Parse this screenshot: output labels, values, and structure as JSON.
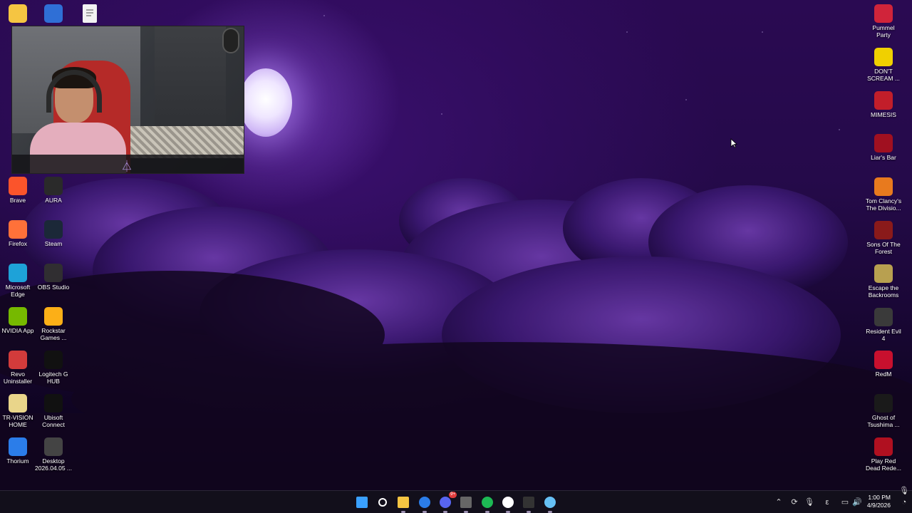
{
  "desktop": {
    "left_column_1": [
      {
        "label": "",
        "icon": "folder-icon",
        "color": "#f5c542"
      },
      {
        "label": "Brave",
        "icon": "brave-icon",
        "color": "#fb542b"
      },
      {
        "label": "Firefox",
        "icon": "firefox-icon",
        "color": "#ff7139"
      },
      {
        "label": "Microsoft Edge",
        "icon": "edge-icon",
        "color": "#1ea2d8"
      },
      {
        "label": "NVIDIA App",
        "icon": "nvidia-icon",
        "color": "#76b900"
      },
      {
        "label": "Revo Uninstaller",
        "icon": "revo-icon",
        "color": "#d23b3b"
      },
      {
        "label": "TR-VISION HOME",
        "icon": "trvision-icon",
        "color": "#e9d58a"
      },
      {
        "label": "Thorium",
        "icon": "thorium-icon",
        "color": "#2b7de9"
      }
    ],
    "left_column_2": [
      {
        "label": "",
        "icon": "settings-app-icon",
        "color": "#2f6fd6"
      },
      {
        "label": "AURA",
        "icon": "aura-icon",
        "color": "#2a2a2a"
      },
      {
        "label": "Steam",
        "icon": "steam-icon",
        "color": "#1b2838"
      },
      {
        "label": "OBS Studio",
        "icon": "obs-icon",
        "color": "#302e31"
      },
      {
        "label": "Rockstar Games ...",
        "icon": "rockstar-icon",
        "color": "#fcaf17"
      },
      {
        "label": "Logitech G HUB",
        "icon": "logitech-icon",
        "color": "#111111"
      },
      {
        "label": "Ubisoft Connect",
        "icon": "ubisoft-icon",
        "color": "#111111"
      },
      {
        "label": "Desktop 2026.04.05 ...",
        "icon": "video-file-icon",
        "color": "#444444"
      }
    ],
    "top_file": {
      "label": "",
      "icon": "document-icon"
    },
    "right_column": [
      {
        "label": "Pummel Party",
        "icon": "pummel-party-icon",
        "color": "#d0243a"
      },
      {
        "label": "DON'T SCREAM ...",
        "icon": "dont-scream-icon",
        "color": "#f0d000"
      },
      {
        "label": "MIMESIS",
        "icon": "mimesis-icon",
        "color": "#c21e2a"
      },
      {
        "label": "Liar's Bar",
        "icon": "liars-bar-icon",
        "color": "#a01020"
      },
      {
        "label": "Tom Clancy's The Divisio...",
        "icon": "division-icon",
        "color": "#e87a1e"
      },
      {
        "label": "Sons Of The Forest",
        "icon": "sons-forest-icon",
        "color": "#8a1a1a"
      },
      {
        "label": "Escape the Backrooms",
        "icon": "backrooms-icon",
        "color": "#b8a050"
      },
      {
        "label": "Resident Evil 4",
        "icon": "re4-icon",
        "color": "#3a3a3a"
      },
      {
        "label": "RedM",
        "icon": "redm-icon",
        "color": "#c8102e"
      },
      {
        "label": "Ghost of Tsushima ...",
        "icon": "ghost-tsushima-icon",
        "color": "#1a1a1a"
      },
      {
        "label": "Play Red Dead Rede...",
        "icon": "rdr-icon",
        "color": "#b01020"
      }
    ]
  },
  "webcam": {
    "overlay_logo": "⏃"
  },
  "taskbar": {
    "apps": [
      {
        "name": "start",
        "icon": "windows-start-icon",
        "color": "#3aa0ff"
      },
      {
        "name": "search",
        "icon": "search-icon",
        "color": "#ffffff"
      },
      {
        "name": "file-explorer",
        "icon": "folder-icon",
        "color": "#f5c542"
      },
      {
        "name": "thorium",
        "icon": "thorium-icon",
        "color": "#2b7de9"
      },
      {
        "name": "discord",
        "icon": "discord-icon",
        "color": "#5865f2",
        "badge": "9+"
      },
      {
        "name": "app",
        "icon": "app-x-icon",
        "color": "#666666"
      },
      {
        "name": "spotify",
        "icon": "spotify-icon",
        "color": "#1db954"
      },
      {
        "name": "obs",
        "icon": "obs-icon",
        "color": "#ffffff"
      },
      {
        "name": "terminal",
        "icon": "terminal-icon",
        "color": "#333333"
      },
      {
        "name": "steam",
        "icon": "steam-icon",
        "color": "#66c0f4"
      }
    ],
    "clock": {
      "time": "1:00 PM",
      "date": "4/9/2026"
    },
    "tray_lang": "ε"
  }
}
